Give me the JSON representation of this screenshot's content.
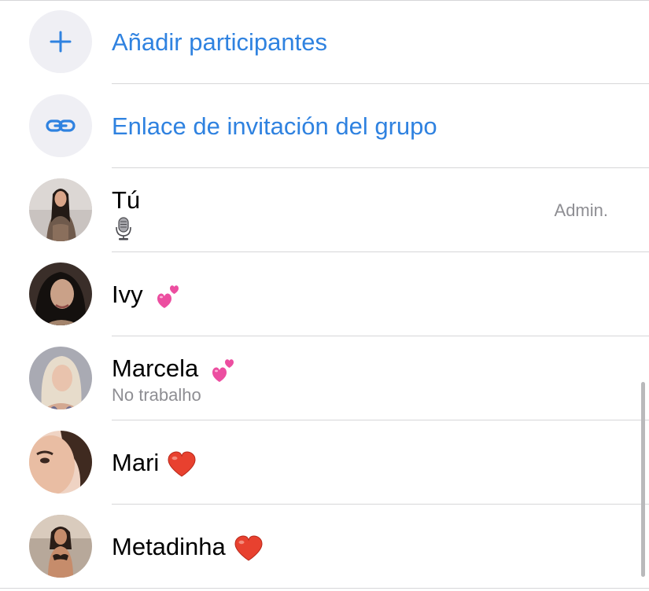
{
  "actions": [
    {
      "label": "Añadir participantes",
      "icon": "plus-icon"
    },
    {
      "label": "Enlace de invitación del grupo",
      "icon": "link-icon"
    }
  ],
  "participants": [
    {
      "name": "Tú",
      "subtitle_icon": "microphone-icon",
      "role": "Admin."
    },
    {
      "name": "Ivy",
      "emoji": "two-hearts-emoji"
    },
    {
      "name": "Marcela",
      "emoji": "two-hearts-emoji",
      "status": "No trabalho"
    },
    {
      "name": "Mari",
      "emoji": "red-heart-emoji"
    },
    {
      "name": "Metadinha",
      "emoji": "red-heart-emoji"
    }
  ],
  "colors": {
    "accent": "#2f82e0",
    "secondary_text": "#8e8e93",
    "separator": "#d6d6d8",
    "icon_background": "#efeff4"
  }
}
